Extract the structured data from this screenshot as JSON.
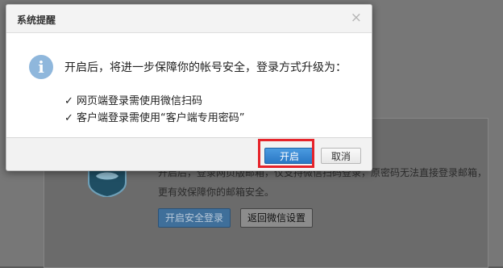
{
  "background": {
    "text_line_1": "开启后，登录网页版邮箱，仅支持微信扫码登录，原密码无法直接登录邮箱，",
    "text_line_2": "更有效保障你的邮箱安全。",
    "enable_button_label": "开启安全登录",
    "back_button_label": "返回微信设置",
    "shield_icon": "shield-icon"
  },
  "dialog": {
    "title": "系统提醒",
    "close_glyph": "×",
    "info_glyph": "i",
    "message": "开启后，将进一步保障你的帐号安全，登录方式升级为：",
    "bullets": [
      "✓ 网页端登录需使用微信扫码",
      "✓ 客户端登录需使用“客户端专用密码”"
    ],
    "buttons": {
      "confirm_label": "开启",
      "cancel_label": "取消"
    }
  },
  "colors": {
    "accent": "#2a78c5",
    "highlight": "#e6232a",
    "overlay": "#777777"
  }
}
